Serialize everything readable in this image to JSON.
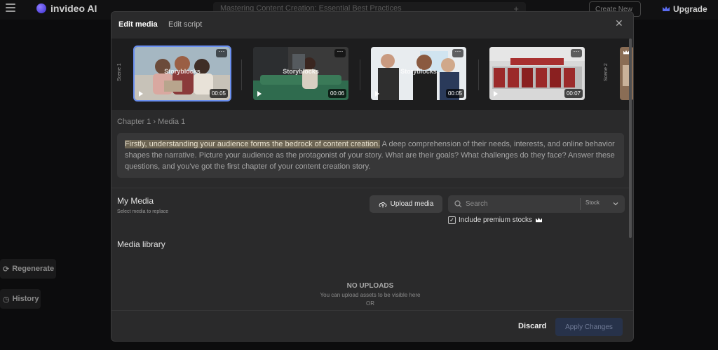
{
  "app": {
    "brand": "invideo AI",
    "project_title": "Mastering Content Creation: Essential Best Practices",
    "create_new": "Create New",
    "upgrade": "Upgrade",
    "regenerate": "Regenerate",
    "history": "History"
  },
  "modal": {
    "tabs": [
      {
        "label": "Edit media",
        "active": true
      },
      {
        "label": "Edit script",
        "active": false
      }
    ],
    "scenes": [
      {
        "label": "Scene 1"
      },
      {
        "label": "Scene 2"
      }
    ],
    "thumbnails": [
      {
        "watermark": "Storyblocks",
        "duration": "00:05",
        "selected": true
      },
      {
        "watermark": "Storyblocks",
        "duration": "00:06",
        "selected": false
      },
      {
        "watermark": "Storyblocks",
        "duration": "00:05",
        "selected": false
      },
      {
        "watermark": "",
        "duration": "00:07",
        "selected": false
      }
    ],
    "breadcrumb": "Chapter 1 › Media 1",
    "script": {
      "highlight": "Firstly, understanding your audience forms the bedrock of content creation.",
      "rest": " A deep comprehension of their needs, interests, and online behavior shapes the narrative. Picture your audience as the protagonist of your story. What are their goals? What challenges do they face? Answer these questions, and you've got the first chapter of your content creation story."
    },
    "my_media": {
      "title": "My Media",
      "subtitle": "Select media to replace",
      "upload_label": "Upload media",
      "search_placeholder": "Search",
      "source": "Stock",
      "premium_label": "Include premium stocks",
      "premium_checked": true
    },
    "library": {
      "title": "Media library",
      "empty_title": "NO UPLOADS",
      "empty_subtitle": "You can upload assets to be visible here",
      "or": "OR"
    },
    "footer": {
      "discard": "Discard",
      "apply": "Apply Changes"
    }
  },
  "colors": {
    "accent": "#6a8ff0",
    "highlight": "#6c6453",
    "apply_disabled": "#27324a"
  }
}
